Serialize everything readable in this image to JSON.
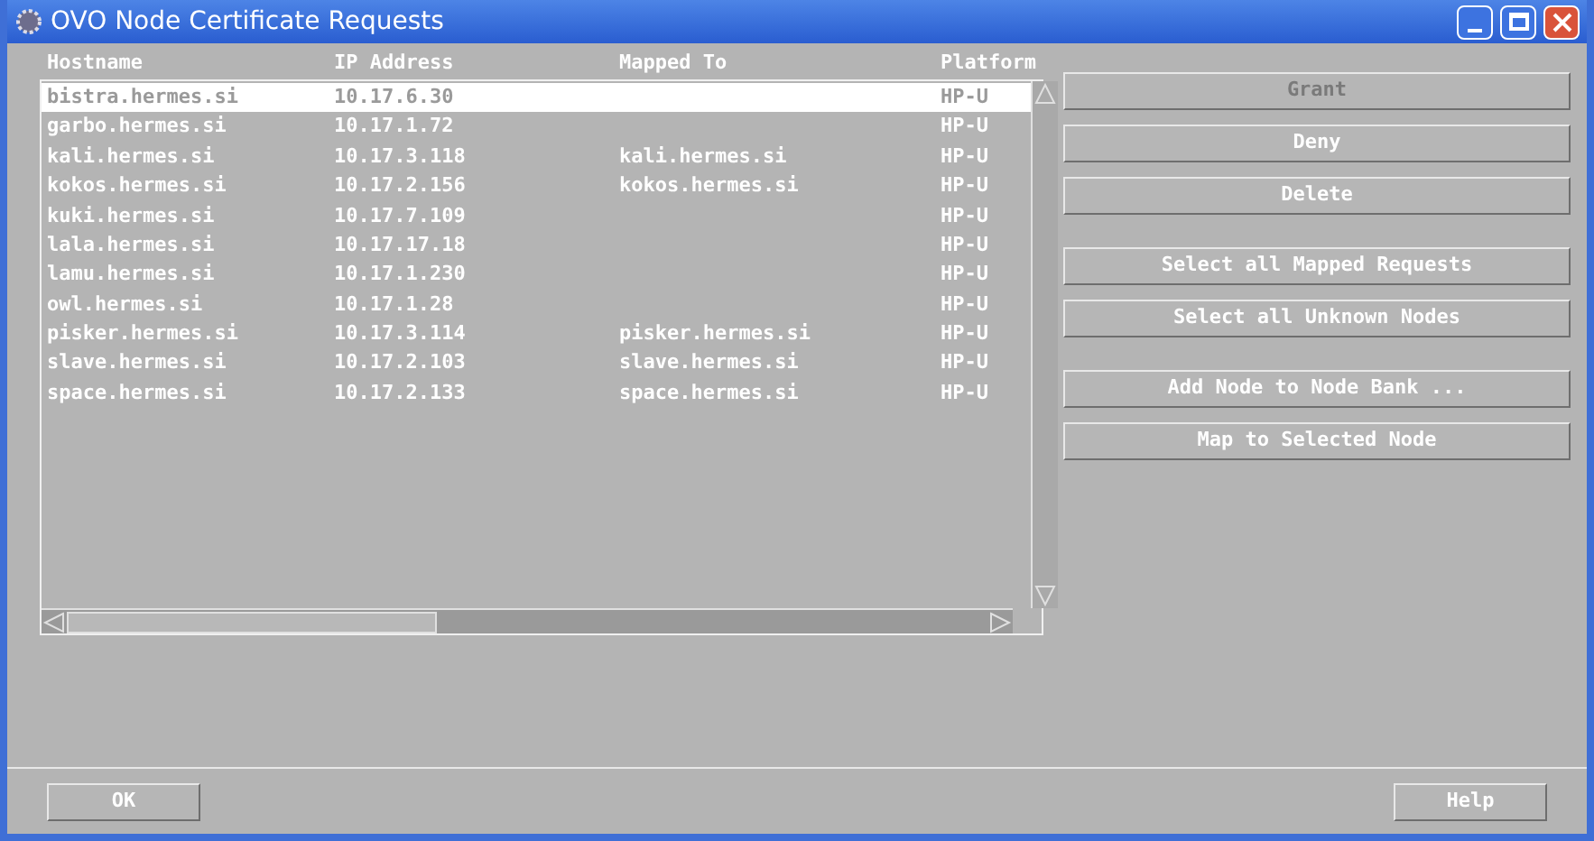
{
  "window": {
    "title": "OVO Node Certificate Requests"
  },
  "table": {
    "columns": [
      "Hostname",
      "IP Address",
      "Mapped To",
      "Platform"
    ],
    "rows": [
      {
        "cells": [
          "bistra.hermes.si",
          "10.17.6.30",
          "",
          "HP-U"
        ],
        "selected": true
      },
      {
        "cells": [
          "garbo.hermes.si",
          "10.17.1.72",
          "",
          "HP-U"
        ],
        "selected": false
      },
      {
        "cells": [
          "kali.hermes.si",
          "10.17.3.118",
          "kali.hermes.si",
          "HP-U"
        ],
        "selected": false
      },
      {
        "cells": [
          "kokos.hermes.si",
          "10.17.2.156",
          "kokos.hermes.si",
          "HP-U"
        ],
        "selected": false
      },
      {
        "cells": [
          "kuki.hermes.si",
          "10.17.7.109",
          "",
          "HP-U"
        ],
        "selected": false
      },
      {
        "cells": [
          "lala.hermes.si",
          "10.17.17.18",
          "",
          "HP-U"
        ],
        "selected": false
      },
      {
        "cells": [
          "lamu.hermes.si",
          "10.17.1.230",
          "",
          "HP-U"
        ],
        "selected": false
      },
      {
        "cells": [
          "owl.hermes.si",
          "10.17.1.28",
          "",
          "HP-U"
        ],
        "selected": false
      },
      {
        "cells": [
          "pisker.hermes.si",
          "10.17.3.114",
          "pisker.hermes.si",
          "HP-U"
        ],
        "selected": false
      },
      {
        "cells": [
          "slave.hermes.si",
          "10.17.2.103",
          "slave.hermes.si",
          "HP-U"
        ],
        "selected": false
      },
      {
        "cells": [
          "space.hermes.si",
          "10.17.2.133",
          "space.hermes.si",
          "HP-U"
        ],
        "selected": false
      }
    ]
  },
  "action_groups": [
    [
      {
        "label": "Grant",
        "disabled": true
      },
      {
        "label": "Deny",
        "disabled": false
      },
      {
        "label": "Delete",
        "disabled": false
      }
    ],
    [
      {
        "label": "Select all Mapped Requests",
        "disabled": false
      },
      {
        "label": "Select all Unknown Nodes",
        "disabled": false
      }
    ],
    [
      {
        "label": "Add Node to Node Bank ...",
        "disabled": false
      },
      {
        "label": "Map to Selected Node",
        "disabled": false
      }
    ]
  ],
  "footer_buttons": [
    "OK",
    "Help"
  ]
}
